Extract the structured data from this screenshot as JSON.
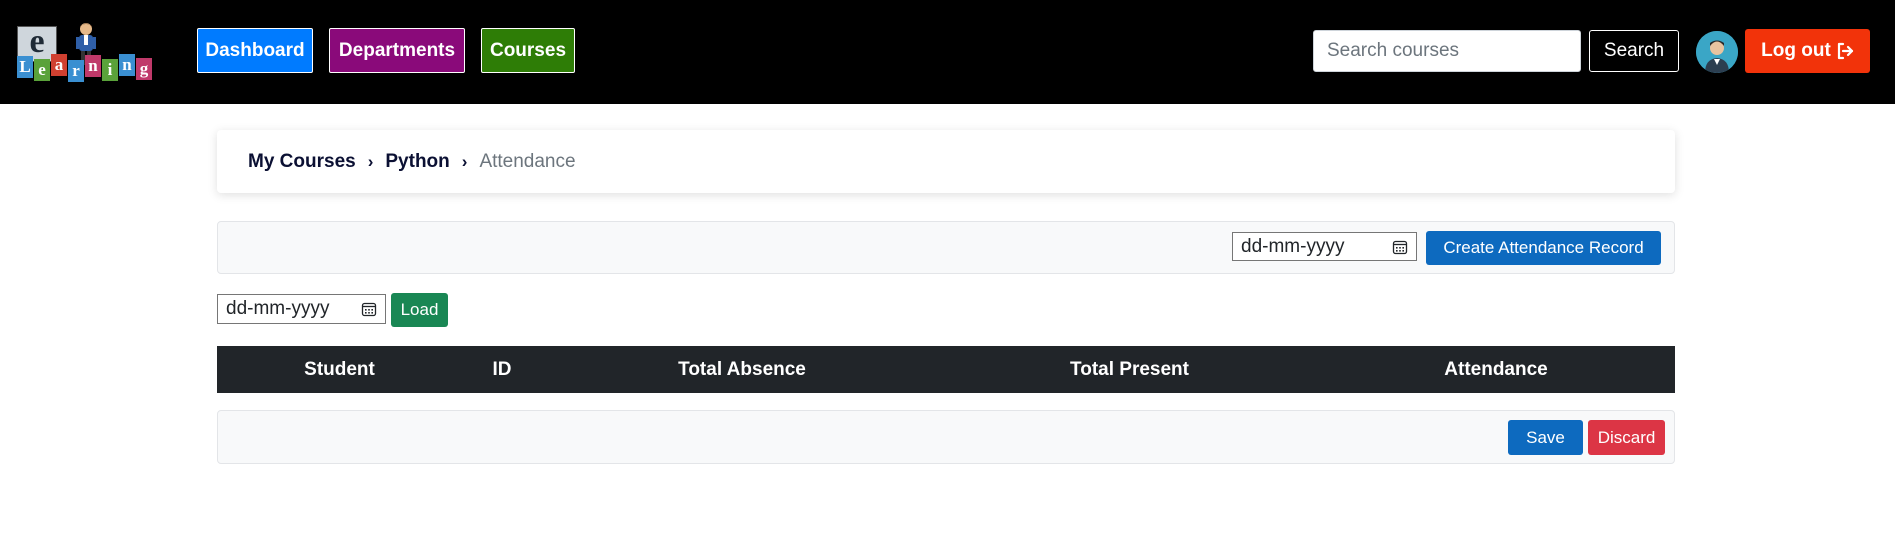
{
  "brand": {
    "logo_big_letter": "e",
    "logo_letters": [
      "L",
      "e",
      "a",
      "r",
      "n",
      "i",
      "n",
      "g"
    ],
    "logo_letter_colors": [
      "#3a8fd1",
      "#5aa23a",
      "#d04030",
      "#3a8fd1",
      "#c0396a",
      "#5aa23a",
      "#3a8fd1",
      "#c0396a"
    ]
  },
  "nav": {
    "dashboard_label": "Dashboard",
    "departments_label": "Departments",
    "courses_label": "Courses"
  },
  "search": {
    "placeholder": "Search courses",
    "button_label": "Search"
  },
  "user": {
    "logout_label": "Log out",
    "logout_icon": "sign-out-icon"
  },
  "breadcrumb": {
    "items": [
      "My Courses",
      "Python"
    ],
    "current": "Attendance"
  },
  "attendance_form": {
    "date_placeholder": "dd-mm-yyyy",
    "create_label": "Create Attendance Record"
  },
  "load_form": {
    "date_placeholder": "dd-mm-yyyy",
    "load_label": "Load"
  },
  "table": {
    "columns": [
      "Student",
      "ID",
      "Total Absence",
      "Total Present",
      "Attendance"
    ]
  },
  "actions": {
    "save_label": "Save",
    "discard_label": "Discard"
  },
  "colors": {
    "navbar_bg": "#000000",
    "dashboard": "#007bff",
    "departments": "#8a0a7a",
    "courses": "#2e7d06",
    "logout": "#f2330a",
    "primary_button": "#0d6abf",
    "success_button": "#198754",
    "danger_button": "#dc3545",
    "table_head": "#212529"
  }
}
